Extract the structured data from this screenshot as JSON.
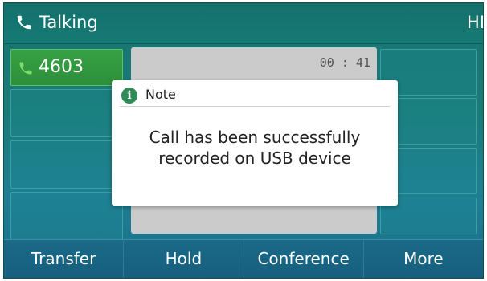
{
  "status": {
    "label": "Talking",
    "hd": "HD"
  },
  "line": {
    "number": "4603"
  },
  "call": {
    "timer": "00 : 41"
  },
  "dialog": {
    "title": "Note",
    "message_line1": "Call has been successfully",
    "message_line2": "recorded on USB device"
  },
  "softkeys": [
    "Transfer",
    "Hold",
    "Conference",
    "More"
  ],
  "colors": {
    "accent_green": "#2d8f3a",
    "background_teal": "#1a7c79",
    "softkey_bar": "#175f7e"
  },
  "icons": {
    "status": "phone-icon",
    "line": "phone-icon",
    "dialog": "info-icon"
  }
}
